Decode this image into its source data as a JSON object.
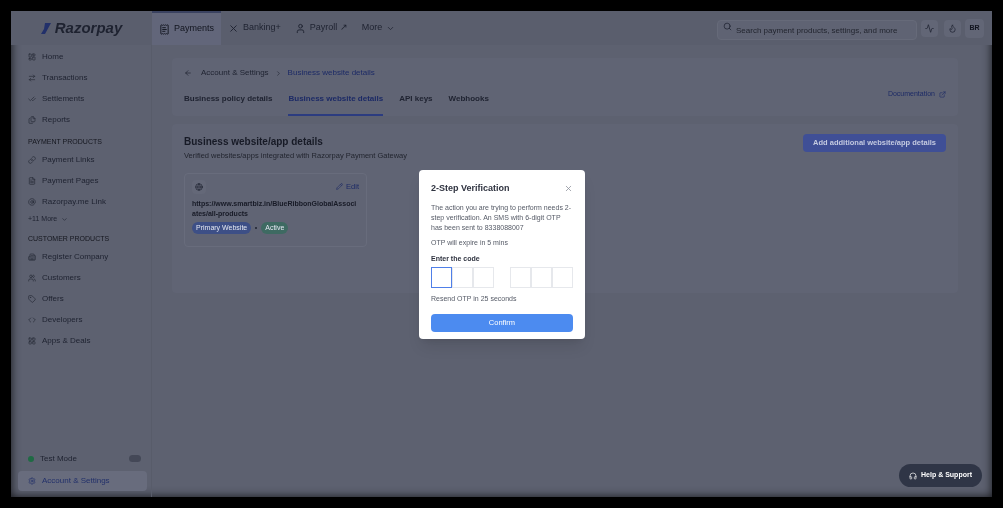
{
  "topbar": {
    "logo": "Razorpay",
    "tabs": [
      {
        "label": "Payments",
        "selected": true
      },
      {
        "label": "Banking+",
        "selected": false
      },
      {
        "label": "Payroll ↗",
        "selected": false
      },
      {
        "label": "More",
        "selected": false
      }
    ],
    "search": {
      "placeholder": "Search payment products, settings, and more"
    },
    "avatar": "BR"
  },
  "sidebar": {
    "sections": [
      {
        "items": [
          {
            "label": "Home"
          },
          {
            "label": "Transactions"
          },
          {
            "label": "Settlements"
          },
          {
            "label": "Reports"
          }
        ]
      },
      {
        "heading": "PAYMENT PRODUCTS",
        "items": [
          {
            "label": "Payment Links"
          },
          {
            "label": "Payment Pages"
          },
          {
            "label": "Razorpay.me Link"
          }
        ],
        "more_link": "+11 More"
      },
      {
        "heading": "CUSTOMER PRODUCTS",
        "items": [
          {
            "label": "Register Company"
          },
          {
            "label": "Customers"
          },
          {
            "label": "Offers"
          },
          {
            "label": "Developers"
          },
          {
            "label": "Apps & Deals"
          }
        ]
      }
    ],
    "test_mode": {
      "label": "Test Mode",
      "on": false
    },
    "account": {
      "label": "Account & Settings",
      "selected": true
    }
  },
  "breadcrumb": [
    "Account & Settings",
    "Business website details"
  ],
  "tabs": [
    {
      "label": "Business policy details",
      "selected": false
    },
    {
      "label": "Business website details",
      "selected": true
    },
    {
      "label": "API keys",
      "selected": false
    },
    {
      "label": "Webhooks",
      "selected": false
    }
  ],
  "documentation_link": "Documentation",
  "section": {
    "title": "Business website/app details",
    "subtitle": "Verified websites/apps integrated with Razorpay Payment Gateway",
    "add_button": "Add additional website/app details",
    "websites": [
      {
        "url": "https://www.smartbiz.in/BlueRibbonGlobalAssociates/all-products",
        "edit": "Edit",
        "tags": [
          {
            "label": "Primary Website",
            "color": "#3d4f86"
          },
          {
            "label": "Active",
            "color": "#3e6a62"
          }
        ]
      }
    ]
  },
  "modal": {
    "title": "2-Step Verification",
    "message": "The action you are trying to perform needs 2-step verification. An SMS with 6-digit OTP has been sent to 8338088007",
    "expiry": "OTP will expire in 5 mins",
    "code_label": "Enter the code",
    "code_boxes": [
      {
        "focused": true
      },
      {
        "focused": false
      },
      {
        "focused": false
      },
      {
        "focused": false
      },
      {
        "focused": false
      },
      {
        "focused": false
      }
    ],
    "resend": "Resend OTP in 25 seconds",
    "confirm": "Confirm"
  },
  "help_button": "Help & Support"
}
